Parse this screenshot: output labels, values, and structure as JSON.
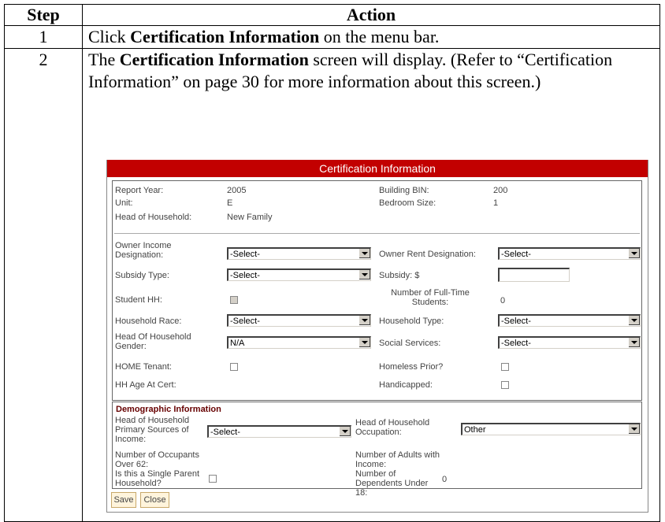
{
  "table": {
    "headers": {
      "step": "Step",
      "action": "Action"
    },
    "rows": [
      {
        "step": "1",
        "pre": "Click ",
        "bold": "Certification Information",
        "post": " on the menu bar."
      },
      {
        "step": "2",
        "pre": "The ",
        "bold": "Certification Information",
        "post": " screen will display. (Refer to “Certification Information” on page 30 for more information about this screen.)"
      }
    ]
  },
  "screen": {
    "title": "Certification Information",
    "report_year_label": "Report Year:",
    "report_year": "2005",
    "unit_label": "Unit:",
    "unit": "E",
    "hoh_label": "Head of Household:",
    "hoh": "New Family",
    "bin_label": "Building BIN:",
    "bin": "200",
    "bedroom_label": "Bedroom Size:",
    "bedroom": "1",
    "owner_income_label": "Owner Income Designation:",
    "owner_income": "-Select-",
    "owner_rent_label": "Owner Rent Designation:",
    "owner_rent": "-Select-",
    "subsidy_type_label": "Subsidy Type:",
    "subsidy_type": "-Select-",
    "subsidy_label": "Subsidy: $",
    "subsidy": "",
    "student_hh_label": "Student HH:",
    "fulltime_label": "Number of Full-Time Students:",
    "fulltime": "0",
    "race_label": "Household Race:",
    "race": "-Select-",
    "hh_type_label": "Household Type:",
    "hh_type": "-Select-",
    "gender_label": "Head Of Household Gender:",
    "gender": "N/A",
    "social_label": "Social Services:",
    "social": "-Select-",
    "home_tenant_label": "HOME Tenant:",
    "homeless_label": "Homeless Prior?",
    "age_label": "HH Age At Cert:",
    "handicapped_label": "Handicapped:",
    "demo_title": "Demographic Information",
    "income_src_label": "Head of Household Primary Sources of Income:",
    "income_src": "-Select-",
    "occupation_label": "Head of Household Occupation:",
    "occupation": "Other",
    "over62_label": "Number of Occupants Over 62:",
    "adults_income_label": "Number of Adults with Income:",
    "single_parent_label": "Is this a Single Parent Household?",
    "dependents_label": "Number of Dependents Under 18:",
    "dependents": "0",
    "save_label": "Save",
    "close_label": "Close"
  }
}
